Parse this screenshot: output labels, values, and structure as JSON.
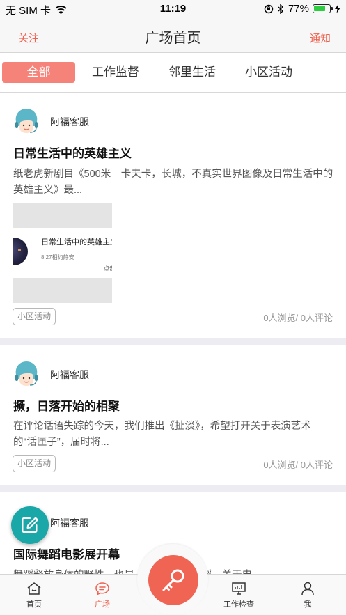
{
  "status_bar": {
    "carrier": "无 SIM 卡",
    "time": "11:19",
    "battery": "77%",
    "battery_level": 0.77
  },
  "nav": {
    "left": "关注",
    "title": "广场首页",
    "right": "通知"
  },
  "tabs": [
    {
      "label": "全部",
      "active": true
    },
    {
      "label": "工作监督",
      "active": false
    },
    {
      "label": "邻里生活",
      "active": false
    },
    {
      "label": "小区活动",
      "active": false
    }
  ],
  "posts": [
    {
      "author": "阿福客服",
      "title": "日常生活中的英雄主义",
      "desc": "纸老虎新剧目《500米－卡夫卡，长城，不真实世界图像及日常生活中的英雄主义》最...",
      "thumbnail": {
        "title": "日常生活中的英雄主义",
        "subtitle": "8.27相约静安",
        "click": "点击"
      },
      "tag": "小区活动",
      "stats": "0人浏览/ 0人评论"
    },
    {
      "author": "阿福客服",
      "title": "撅，日落开始的相聚",
      "desc": "在评论话语失踪的今天，我们推出《扯淡》，希望打开关于表演艺术的“话匣子”，届时将...",
      "tag": "小区活动",
      "stats": "0人浏览/ 0人评论"
    },
    {
      "author": "阿福客服",
      "title": "国际舞蹈电影展开幕",
      "desc": "舞蹈释放身体的野性，也是......能，关于舞蹈，关于电"
    }
  ],
  "bottom_nav": [
    {
      "label": "首页",
      "icon": "home-icon",
      "active": false
    },
    {
      "label": "广场",
      "icon": "chat-icon",
      "active": true
    },
    {
      "label": "工作检查",
      "icon": "monitor-icon",
      "active": false
    },
    {
      "label": "我",
      "icon": "person-icon",
      "active": false
    }
  ],
  "center_action": {
    "icon": "key-icon"
  },
  "colors": {
    "accent": "#f0624f",
    "tab_active_bg": "#f5837a",
    "fab": "#1aa7a8",
    "separator": "#ececf2"
  }
}
